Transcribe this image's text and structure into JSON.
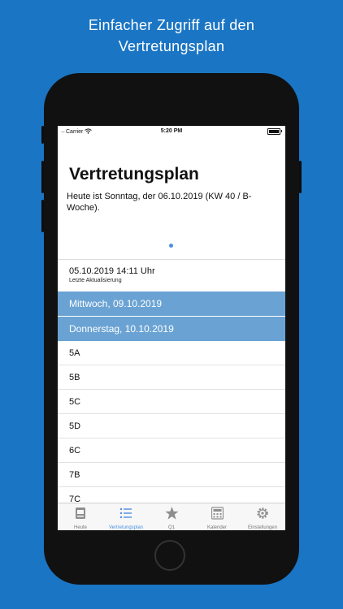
{
  "promo": {
    "line1": "Einfacher Zugriff auf den",
    "line2": "Vertretungsplan"
  },
  "status_bar": {
    "carrier": "Carrier",
    "time": "5:20 PM"
  },
  "header": {
    "title": "Vertretungsplan",
    "subtitle": "Heute ist Sonntag, der 06.10.2019  (KW 40 / B-Woche)."
  },
  "update": {
    "time": "05.10.2019 14:11 Uhr",
    "label": "Letzte Aktualisierung"
  },
  "days": [
    {
      "label": "Mittwoch, 09.10.2019"
    },
    {
      "label": "Donnerstag, 10.10.2019"
    }
  ],
  "classes": [
    {
      "label": "5A"
    },
    {
      "label": "5B"
    },
    {
      "label": "5C"
    },
    {
      "label": "5D"
    },
    {
      "label": "6C"
    },
    {
      "label": "7B"
    },
    {
      "label": "7C"
    }
  ],
  "tabbar": {
    "items": [
      {
        "label": "Heute",
        "icon": "document-icon"
      },
      {
        "label": "Vertretungsplan",
        "icon": "list-icon",
        "active": true
      },
      {
        "label": "Q1",
        "icon": "star-icon"
      },
      {
        "label": "Kalender",
        "icon": "calculator-icon"
      },
      {
        "label": "Einstellungen",
        "icon": "gear-icon"
      }
    ]
  },
  "colors": {
    "background": "#1a75c4",
    "day_row": "#6aa3d3",
    "active_tab": "#4a90e2"
  }
}
